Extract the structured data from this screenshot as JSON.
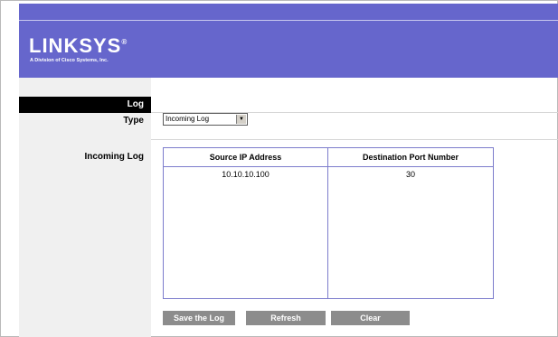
{
  "brand": {
    "logo_text": "LINKSYS",
    "registered": "®",
    "tagline": "A Division of Cisco Systems, Inc."
  },
  "section": {
    "title": "Log"
  },
  "type_row": {
    "label": "Type",
    "selected": "Incoming Log"
  },
  "incoming_log": {
    "label": "Incoming Log",
    "columns": [
      "Source IP Address",
      "Destination Port Number"
    ],
    "rows": [
      [
        "10.10.10.100",
        "30"
      ]
    ]
  },
  "buttons": {
    "save": "Save the Log",
    "refresh": "Refresh",
    "clear": "Clear"
  },
  "colors": {
    "header": "#6666cc",
    "sidebar": "#f0f0f0",
    "button": "#8c8c8c",
    "table_border": "#7c7ccc"
  }
}
